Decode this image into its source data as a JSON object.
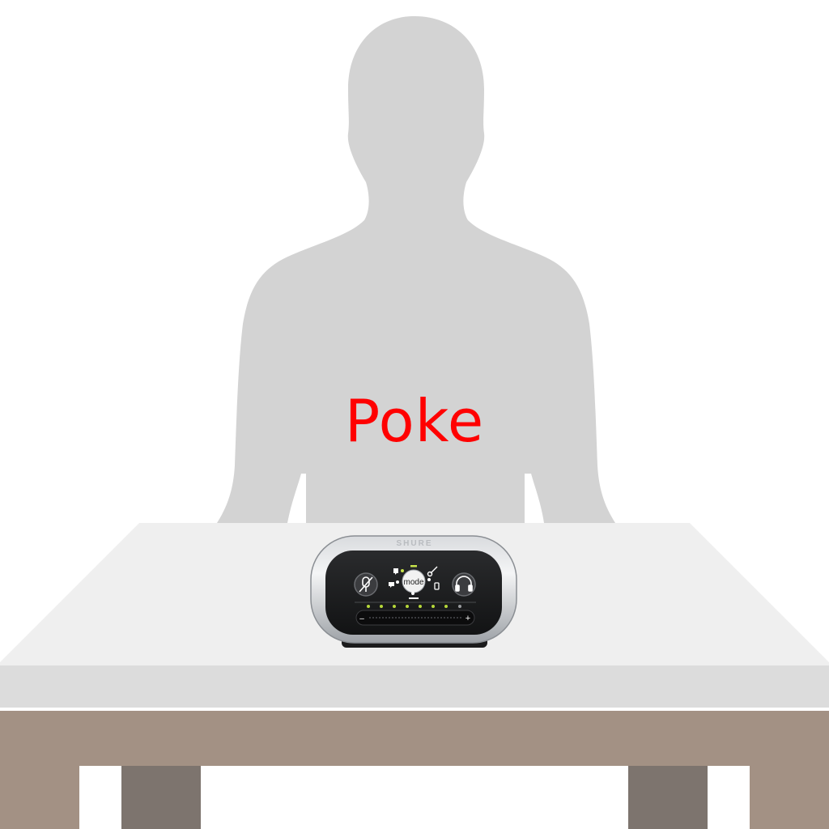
{
  "scene": {
    "action_label": "Poke",
    "label_color": "#ff0000",
    "silhouette_color": "#d3d3d3",
    "table_top_color": "#efefef",
    "table_edge_color": "#dcdcdc",
    "table_apron_color": "#a39184",
    "table_leg_color": "#7d746e"
  },
  "device": {
    "brand": "SHURE",
    "mode_label": "mode",
    "slider_minus": "–",
    "slider_plus": "+",
    "icons": [
      "mic-mute-icon",
      "voice-icon",
      "singer-icon",
      "guitar-icon",
      "flat-icon",
      "headphone-icon"
    ]
  }
}
